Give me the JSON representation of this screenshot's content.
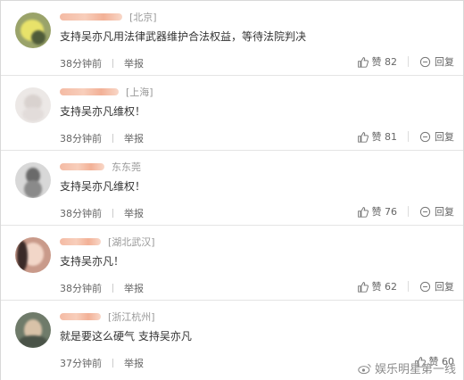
{
  "comments": [
    {
      "location": "[北京]",
      "text": "支持吴亦凡用法律武器维护合法权益，等待法院判决",
      "time": "38分钟前",
      "report_label": "举报",
      "like_label": "赞",
      "like_count": "82",
      "reply_label": "回复"
    },
    {
      "location": "[上海]",
      "text": "支持吴亦凡维权！",
      "time": "38分钟前",
      "report_label": "举报",
      "like_label": "赞",
      "like_count": "81",
      "reply_label": "回复"
    },
    {
      "location": "东东莞",
      "text": "支持吴亦凡维权！",
      "time": "38分钟前",
      "report_label": "举报",
      "like_label": "赞",
      "like_count": "76",
      "reply_label": "回复"
    },
    {
      "location": "[湖北武汉]",
      "text": "支持吴亦凡！",
      "time": "38分钟前",
      "report_label": "举报",
      "like_label": "赞",
      "like_count": "62",
      "reply_label": "回复"
    },
    {
      "location": "[浙江杭州]",
      "text": "就是要这么硬气 支持吴亦凡",
      "time": "37分钟前",
      "report_label": "举报",
      "like_label": "赞",
      "like_count": "60",
      "reply_label": "回复"
    }
  ],
  "watermark": {
    "text": "娱乐明星第一线"
  },
  "colors": {
    "name_blur": "#f3b39a",
    "text": "#333333",
    "meta": "#666666",
    "location": "#999999"
  },
  "icons": {
    "like": "thumbs-up-icon",
    "reply": "comment-bubble-icon",
    "watermark_logo": "weibo-logo"
  }
}
